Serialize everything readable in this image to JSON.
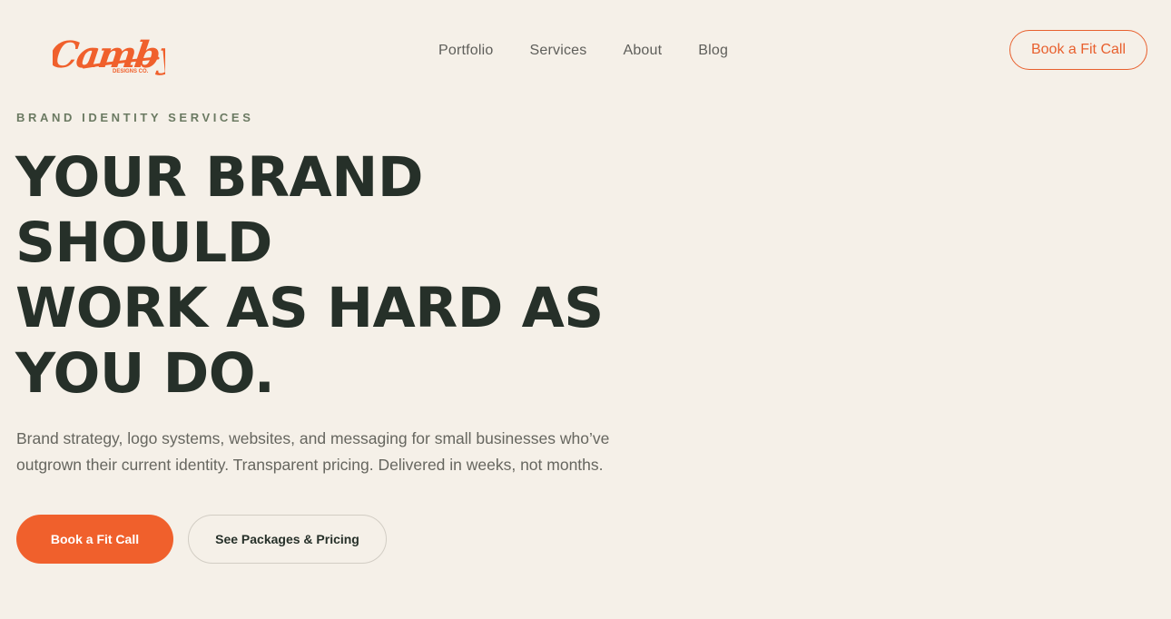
{
  "brand": {
    "logo_script": "Camby",
    "logo_subtitle": "DESIGNS CO.",
    "accent_color": "#f0602c"
  },
  "nav": {
    "items": [
      {
        "label": "Portfolio"
      },
      {
        "label": "Services"
      },
      {
        "label": "About"
      },
      {
        "label": "Blog"
      }
    ],
    "cta_label": "Book a Fit Call"
  },
  "hero": {
    "eyebrow": "BRAND IDENTITY SERVICES",
    "headline_lines": [
      "YOUR BRAND",
      "SHOULD",
      "WORK AS HARD AS",
      "YOU DO."
    ],
    "subcopy_lines": [
      "Brand strategy, logo systems, websites, and messaging for small businesses who’ve",
      "outgrown their current identity. Transparent pricing. Delivered in weeks, not months."
    ],
    "primary_cta": "Book a Fit Call",
    "secondary_cta": "See Packages & Pricing"
  }
}
